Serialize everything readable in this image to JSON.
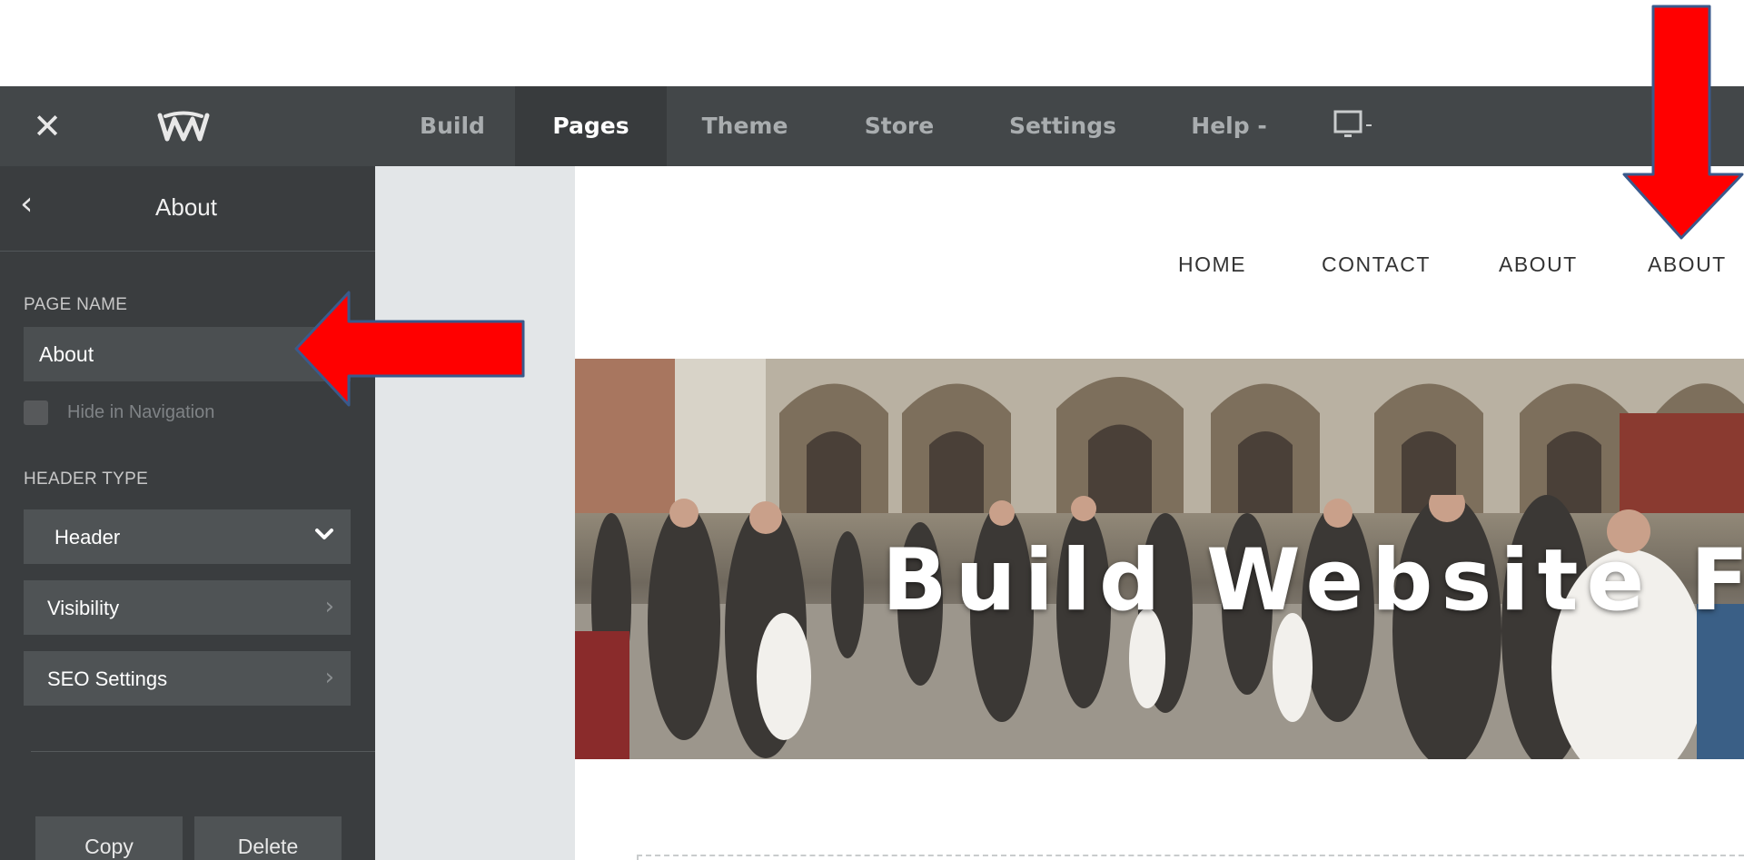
{
  "topbar": {
    "close_label": "✕",
    "logo_icon": "weebly-logo-icon",
    "tabs": [
      {
        "label": "Build",
        "active": false
      },
      {
        "label": "Pages",
        "active": true
      },
      {
        "label": "Theme",
        "active": false
      },
      {
        "label": "Store",
        "active": false
      },
      {
        "label": "Settings",
        "active": false
      },
      {
        "label": "Help -",
        "active": false
      }
    ],
    "device_icon": "monitor-dropdown-icon"
  },
  "sidebar": {
    "title": "About",
    "page_name_label": "PAGE NAME",
    "page_name_value": "About",
    "hide_in_navigation_label": "Hide in Navigation",
    "hide_in_navigation_checked": false,
    "header_type_label": "HEADER TYPE",
    "header_type_value": "Header",
    "visibility_label": "Visibility",
    "seo_settings_label": "SEO Settings",
    "copy_label": "Copy",
    "delete_label": "Delete"
  },
  "site": {
    "nav": [
      "HOME",
      "CONTACT",
      "ABOUT",
      "ABOUT"
    ],
    "hero_title": "Build Website Free C"
  },
  "colors": {
    "topbar_bg": "#434749",
    "sidebar_bg": "#3a3d3f",
    "gutter_bg": "#e3e6e8",
    "arrow_fill": "#ff0000",
    "arrow_stroke": "#3a5a8c"
  }
}
